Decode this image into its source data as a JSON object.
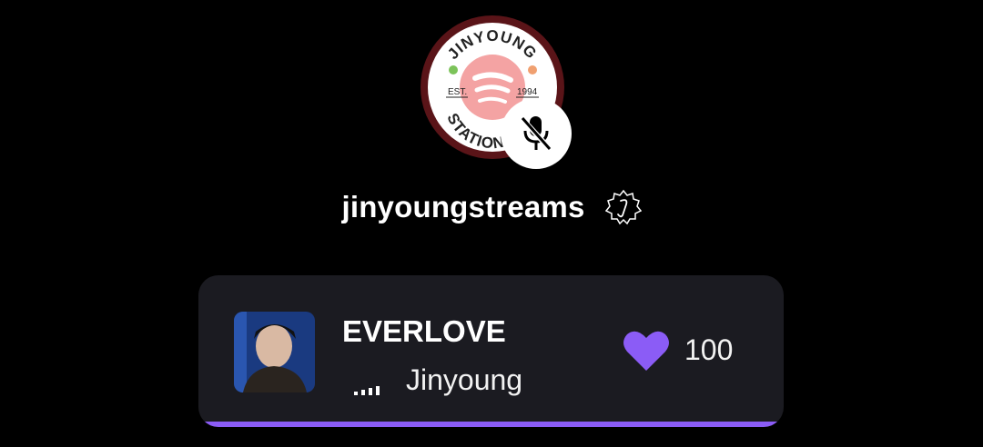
{
  "profile": {
    "username": "jinyoungstreams",
    "avatar_text": {
      "top": "JINYOUNG",
      "est": "EST.",
      "year": "1994",
      "bottom": "STATION"
    }
  },
  "now_playing": {
    "title": "EVERLOVE",
    "artist": "Jinyoung",
    "likes": "100",
    "progress": 1.0
  },
  "colors": {
    "background": "#000000",
    "card": "#1b1b21",
    "accent": "#8b5cf6",
    "ring": "#5a1418",
    "logo_pink": "#f4a3a3"
  },
  "icons": {
    "mute": "mic-off-icon",
    "verified": "verified-badge-icon",
    "like": "heart-icon",
    "playing": "equalizer-icon"
  }
}
